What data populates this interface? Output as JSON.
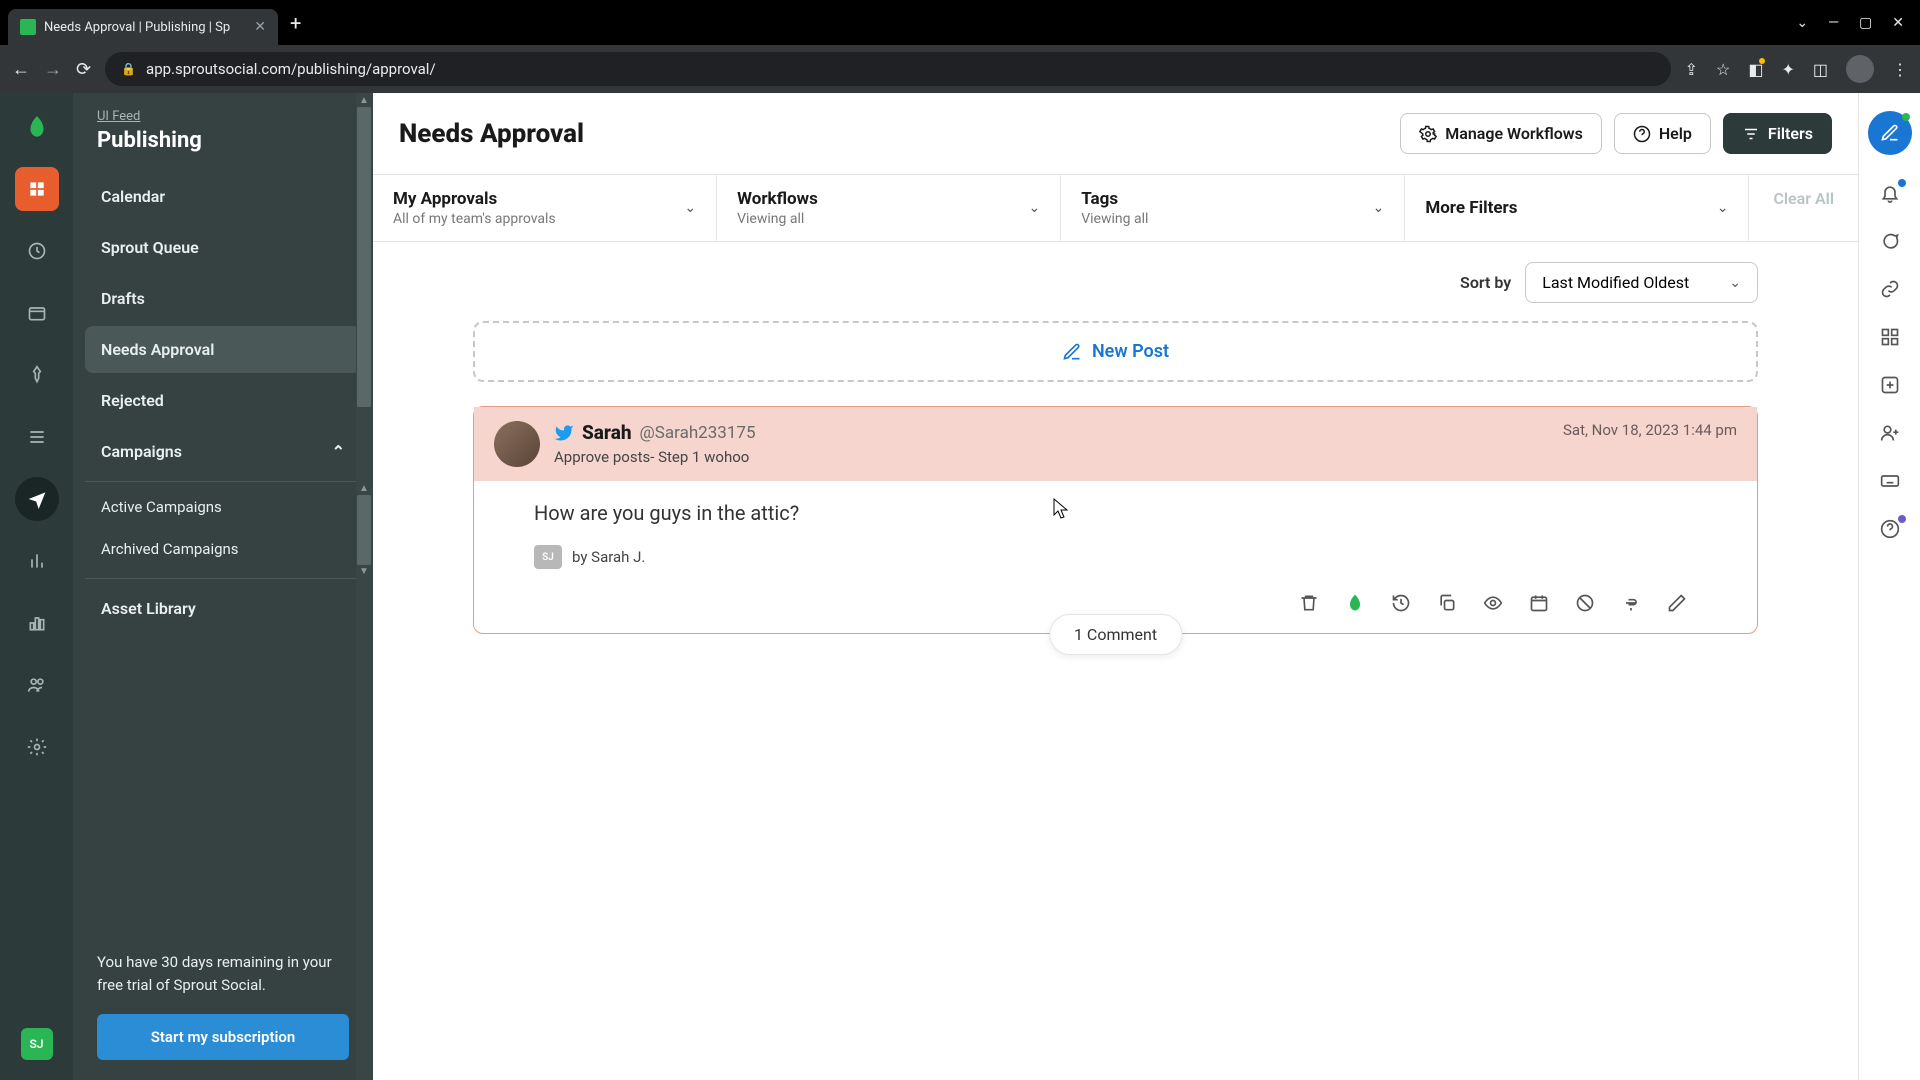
{
  "browser": {
    "tab_title": "Needs Approval | Publishing | Sp",
    "url": "app.sproutsocial.com/publishing/approval/"
  },
  "sidebar": {
    "eyebrow": "UI Feed",
    "title": "Publishing",
    "items": [
      {
        "label": "Calendar"
      },
      {
        "label": "Sprout Queue"
      },
      {
        "label": "Drafts"
      },
      {
        "label": "Needs Approval"
      },
      {
        "label": "Rejected"
      },
      {
        "label": "Campaigns"
      }
    ],
    "sub_items": [
      {
        "label": "Active Campaigns"
      },
      {
        "label": "Archived Campaigns"
      }
    ],
    "asset_label": "Asset Library",
    "trial_text": "You have 30 days remaining in your free trial of Sprout Social.",
    "trial_button": "Start my subscription",
    "user_initials": "SJ"
  },
  "header": {
    "title": "Needs Approval",
    "manage_workflows": "Manage Workflows",
    "help": "Help",
    "filters": "Filters"
  },
  "filters": {
    "approvals": {
      "label": "My Approvals",
      "sub": "All of my team's approvals"
    },
    "workflows": {
      "label": "Workflows",
      "sub": "Viewing all"
    },
    "tags": {
      "label": "Tags",
      "sub": "Viewing all"
    },
    "more": {
      "label": "More Filters"
    },
    "clear": "Clear All"
  },
  "sort": {
    "label": "Sort by",
    "value": "Last Modified Oldest"
  },
  "new_post": "New Post",
  "post": {
    "name": "Sarah",
    "handle": "@Sarah233175",
    "step": "Approve posts- Step 1 wohoo",
    "date": "Sat, Nov 18, 2023 1:44 pm",
    "text": "How are you guys in the attic?",
    "author_initials": "SJ",
    "author": "by Sarah J.",
    "comment_count": "1 Comment"
  }
}
